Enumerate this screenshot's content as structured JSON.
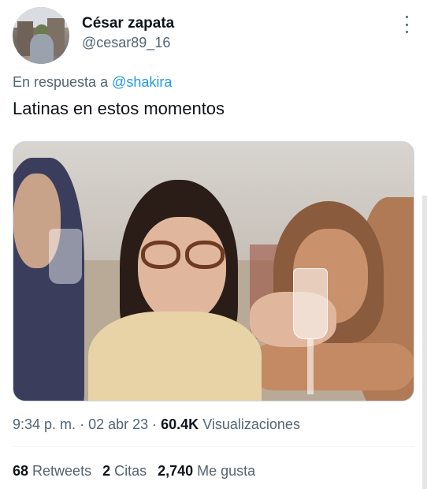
{
  "author": {
    "display_name": "César zapata",
    "handle": "@cesar89_16"
  },
  "reply_context": {
    "prefix": "En respuesta a",
    "mention": "@shakira"
  },
  "tweet_text": "Latinas en estos momentos",
  "meta": {
    "time": "9:34 p. m.",
    "date": "02 abr 23",
    "views_count": "60.4K",
    "views_label": "Visualizaciones"
  },
  "stats": {
    "retweets_count": "68",
    "retweets_label": "Retweets",
    "quotes_count": "2",
    "quotes_label": "Citas",
    "likes_count": "2,740",
    "likes_label": "Me gusta"
  },
  "icons": {
    "more": "more-options-icon"
  },
  "colors": {
    "link": "#1d9bf0",
    "secondary_text": "#536471",
    "primary_text": "#0f1419"
  }
}
